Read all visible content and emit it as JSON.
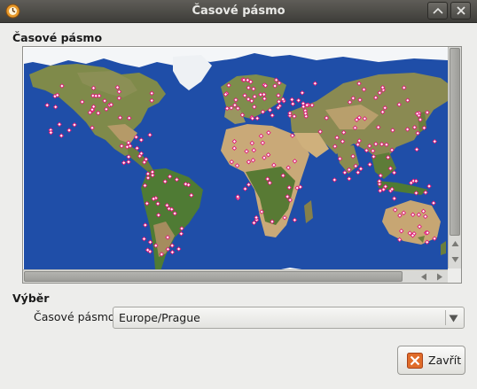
{
  "window": {
    "title": "Časové pásmo"
  },
  "map_section": {
    "title": "Časové pásmo"
  },
  "selection_section": {
    "title": "Výběr",
    "timezone_label": "Časové pásmo:",
    "timezone_value": "Europe/Prague"
  },
  "buttons": {
    "close_label": "Zavřít"
  },
  "icons": {
    "app": "timezone-app-icon",
    "minimize": "minimize-icon",
    "close_window": "close-icon",
    "combo_arrow": "chevron-down-icon",
    "close_button": "close-x-icon"
  },
  "colors": {
    "ocean": "#1f4ea8",
    "marker": "#e21a7a",
    "close_icon": "#e06c2a"
  }
}
